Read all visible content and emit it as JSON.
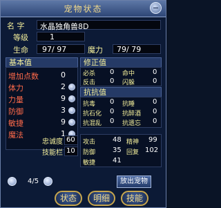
{
  "window": {
    "title": "宠物状态"
  },
  "pet": {
    "name_label": "名 字",
    "name_value": "水晶独角兽8D",
    "level_label": "等级",
    "level_value": "1",
    "hp_label": "生命",
    "hp_value": "97/  97",
    "mp_label": "魔力",
    "mp_value": "79/  79"
  },
  "base": {
    "header": "基本值",
    "items": [
      {
        "label": "增加点数",
        "value": "0"
      },
      {
        "label": "体力",
        "value": "2"
      },
      {
        "label": "力量",
        "value": "9"
      },
      {
        "label": "防御",
        "value": "3"
      },
      {
        "label": "敏捷",
        "value": "9"
      },
      {
        "label": "魔法",
        "value": "1"
      }
    ]
  },
  "correction": {
    "header": "修正值",
    "items": [
      {
        "label": "必杀",
        "value": "0"
      },
      {
        "label": "命中",
        "value": "0"
      },
      {
        "label": "反击",
        "value": "0"
      },
      {
        "label": "闪躲",
        "value": "0"
      }
    ]
  },
  "resist": {
    "header": "抗抗值",
    "items": [
      {
        "label": "抗毒",
        "value": "0"
      },
      {
        "label": "抗睡",
        "value": "0"
      },
      {
        "label": "抗石化",
        "value": "0"
      },
      {
        "label": "抗醉酒",
        "value": "0"
      },
      {
        "label": "抗混乱",
        "value": "0"
      },
      {
        "label": "抗遗忘",
        "value": "0"
      }
    ]
  },
  "extra_left": [
    {
      "label": "忠诚度",
      "value": "60"
    },
    {
      "label": "技能栏",
      "value": "10"
    }
  ],
  "extra_right": [
    {
      "label": "攻击",
      "value": "48"
    },
    {
      "label": "精神",
      "value": "99"
    },
    {
      "label": "防御",
      "value": "35"
    },
    {
      "label": "回复",
      "value": "102"
    },
    {
      "label": "敏捷",
      "value": "41"
    }
  ],
  "pager": {
    "text": "4/5"
  },
  "buttons": {
    "release": "放出宠物",
    "status": "状态",
    "detail": "明细",
    "skill": "技能"
  }
}
